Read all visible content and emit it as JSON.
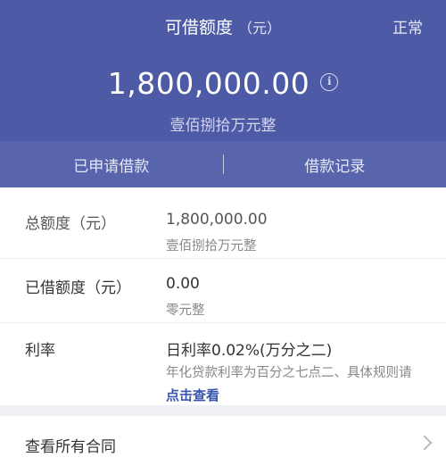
{
  "header": {
    "title": "可借额度",
    "title_unit": "（元）",
    "status": "正常",
    "amount": "1,800,000.00",
    "amount_cn": "壹佰捌拾万元整",
    "colors": {
      "primary": "#4d5aa5",
      "tabbar": "#5865ad"
    }
  },
  "tabs": [
    {
      "label": "已申请借款"
    },
    {
      "label": "借款记录"
    }
  ],
  "details": {
    "total": {
      "label": "总额度（元）",
      "value": "1,800,000.00",
      "sub": "壹佰捌拾万元整"
    },
    "borrowed": {
      "label": "已借额度（元）",
      "value": "0.00",
      "sub": "零元整"
    },
    "rate": {
      "label": "利率",
      "value": "日利率0.02%(万分之二)",
      "sub": "年化贷款利率为百分之七点二、具体规则请",
      "link": "点击查看"
    }
  },
  "contracts": {
    "label": "查看所有合同"
  },
  "icons": {
    "info": "info-icon",
    "chevron": "chevron-right-icon"
  }
}
